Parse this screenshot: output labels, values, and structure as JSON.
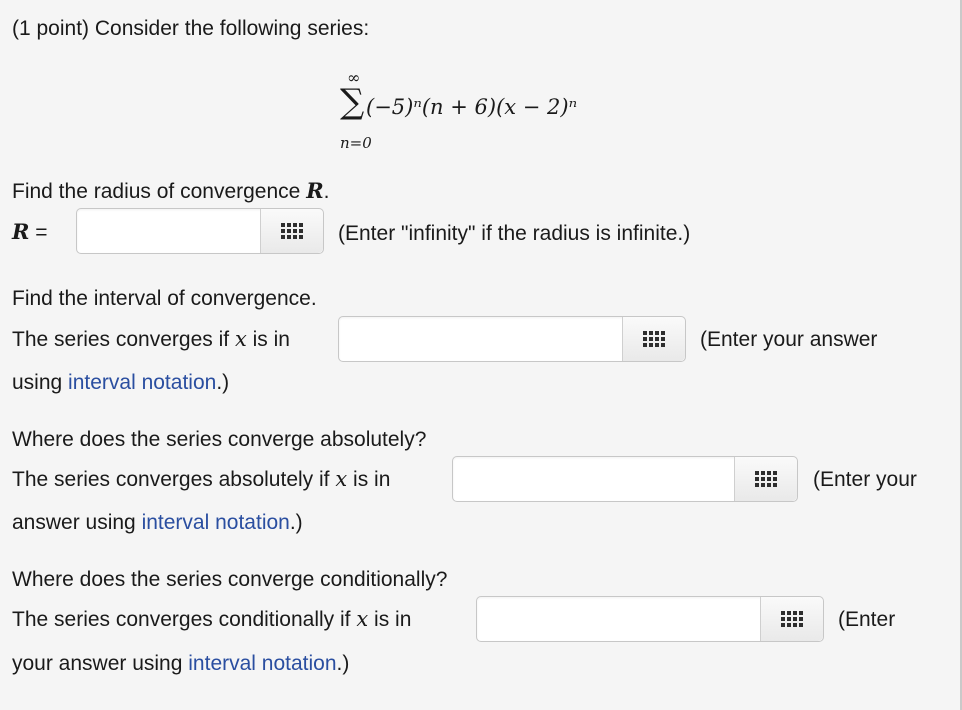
{
  "problem": {
    "header": "(1 point) Consider the following series:",
    "series": {
      "sigma": "∑",
      "upper": "∞",
      "lower": "n=0",
      "term": "(−5)ⁿ(n + 6)(x − 2)ⁿ"
    }
  },
  "radius": {
    "prompt": "Find the radius of convergence",
    "variable": "R",
    "label_eq": "=",
    "input_value": "",
    "hint": "(Enter \"infinity\" if the radius is infinite.)"
  },
  "interval": {
    "heading": "Find the interval of convergence.",
    "prompt": "The series converges if",
    "var": "x",
    "is_in": "is in",
    "input_value": "",
    "hint_start": "(Enter your answer",
    "hint_rest": "using",
    "link": "interval notation",
    "hint_end": ".)"
  },
  "absolute": {
    "heading": "Where does the series converge absolutely?",
    "prompt": "The series converges absolutely if",
    "var": "x",
    "is_in": "is in",
    "input_value": "",
    "hint_start": "(Enter your",
    "hint_rest": "answer using",
    "link": "interval notation",
    "hint_end": ".)"
  },
  "conditional": {
    "heading": "Where does the series converge conditionally?",
    "prompt": "The series converges conditionally if",
    "var": "x",
    "is_in": "is in",
    "input_value": "",
    "hint_start": "(Enter",
    "hint_rest": "your answer using",
    "link": "interval notation",
    "hint_end": ".)"
  },
  "icons": {
    "palette_button": "keyboard-grid-icon"
  },
  "colors": {
    "link": "#2a4ea0",
    "background": "#f5f5f5"
  }
}
